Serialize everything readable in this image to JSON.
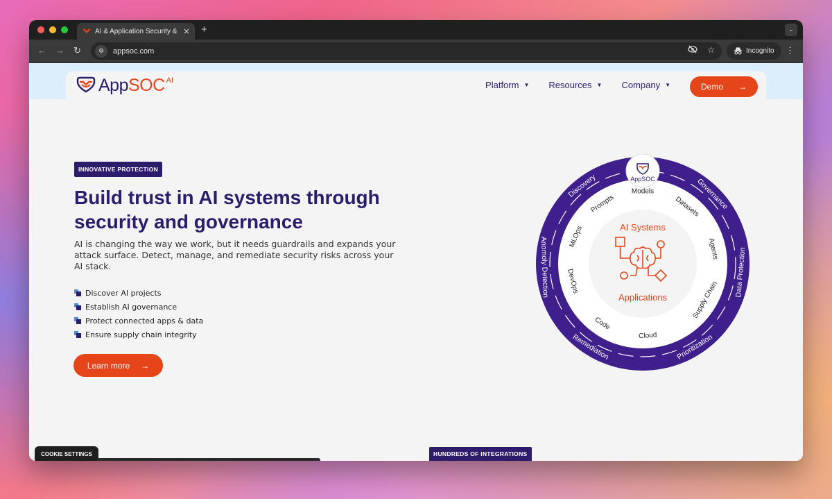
{
  "browser": {
    "tab_title": "AI & Application Security & G",
    "tab_close": "✕",
    "new_tab": "+",
    "url": "appsoc.com",
    "incognito_label": "Incognito",
    "icons": [
      "back-arrow",
      "forward-arrow",
      "reload",
      "site-info",
      "eye-off",
      "star",
      "incognito",
      "more-vertical"
    ]
  },
  "nav": {
    "logo_main": "App",
    "logo_accent": "SOC",
    "logo_sup": "AI",
    "items": [
      {
        "label": "Platform"
      },
      {
        "label": "Resources"
      },
      {
        "label": "Company"
      }
    ],
    "demo_label": "Demo"
  },
  "hero": {
    "badge": "INNOVATIVE PROTECTION",
    "headline": "Build trust in AI systems through security and governance",
    "lede": "AI is changing the way we work, but it needs guardrails and expands your attack surface. Detect, manage, and remediate security risks across your AI stack.",
    "features": [
      "Discover AI projects",
      "Establish AI governance",
      "Protect connected apps & data",
      "Ensure supply chain integrity"
    ],
    "cta_label": "Learn more"
  },
  "diagram": {
    "center_top": "AI Systems",
    "center_bottom": "Applications",
    "badge_label": "AppSOC",
    "inner_labels": [
      "Models",
      "Datasets",
      "Agents",
      "Supply Chain",
      "Cloud",
      "Code",
      "DevOps",
      "MLOps",
      "Prompts"
    ],
    "outer_labels": [
      "Governance",
      "Data Protection",
      "Prioritization",
      "Remediation",
      "Anomoly Detection",
      "Discovery"
    ]
  },
  "footer": {
    "cookie_label": "COOKIE SETTINGS",
    "integrations_badge": "HUNDREDS OF INTEGRATIONS"
  },
  "colors": {
    "brand_purple": "#2d1c6b",
    "ring_purple": "#3e1f8c",
    "accent_orange": "#e6451a",
    "page_bg": "#f4f4f5"
  }
}
